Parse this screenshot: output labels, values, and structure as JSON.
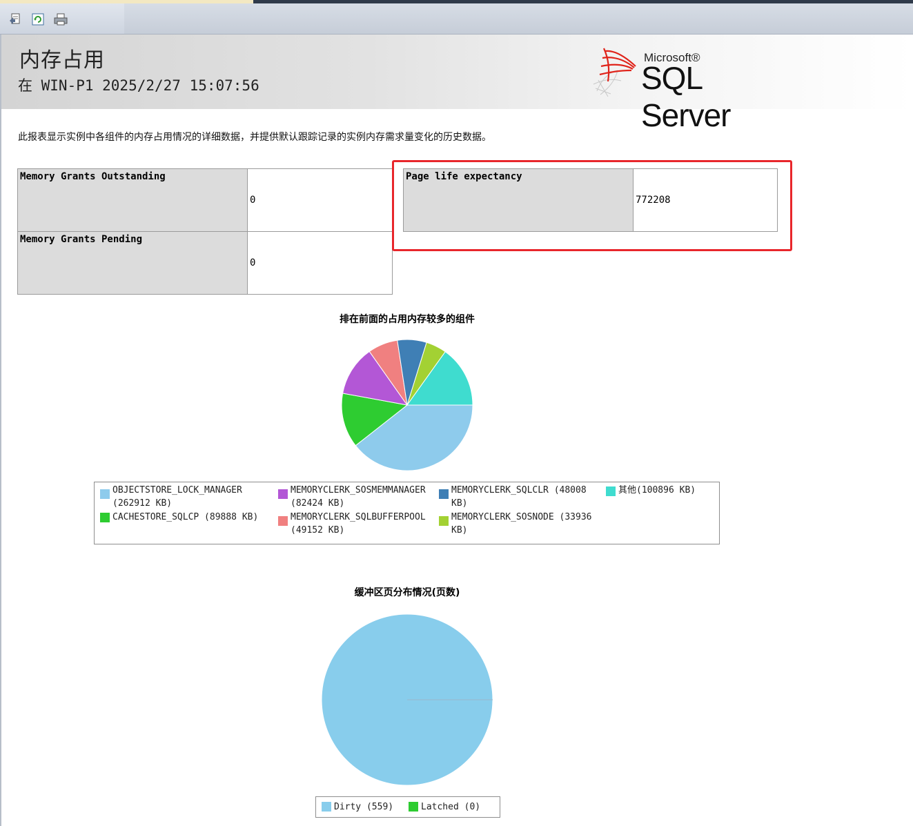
{
  "report": {
    "title": "内存占用",
    "subtitle": "在 WIN-P1 2025/2/27 15:07:56",
    "description": "此报表显示实例中各组件的内存占用情况的详细数据，并提供默认跟踪记录的实例内存需求量变化的历史数据。"
  },
  "logo": {
    "vendor": "Microsoft®",
    "product": "SQL Server"
  },
  "toolbar": {
    "icons": [
      "document-map-icon",
      "refresh-icon",
      "print-icon"
    ]
  },
  "stats": {
    "grants_outstanding": {
      "label": "Memory Grants Outstanding",
      "value": "0"
    },
    "grants_pending": {
      "label": "Memory Grants Pending",
      "value": "0"
    },
    "page_life": {
      "label": "Page life expectancy",
      "value": "772208"
    }
  },
  "legend1": {
    "items": [
      {
        "text1": "OBJECTSTORE_LOCK_MANAGER",
        "text2": "(262912 KB)"
      },
      {
        "text1": "CACHESTORE_SQLCP (89888 KB)",
        "text2": ""
      },
      {
        "text1": "MEMORYCLERK_SOSMEMMANAGER",
        "text2": "(82424 KB)"
      },
      {
        "text1": "MEMORYCLERK_SQLBUFFERPOOL",
        "text2": "(49152 KB)"
      },
      {
        "text1": "MEMORYCLERK_SQLCLR (48008",
        "text2": "KB)"
      },
      {
        "text1": "MEMORYCLERK_SOSNODE (33936",
        "text2": "KB)"
      },
      {
        "text1": "其他(100896 KB)",
        "text2": ""
      }
    ]
  },
  "legend2": {
    "items": [
      {
        "text": "Dirty (559)"
      },
      {
        "text": "Latched (0)"
      }
    ]
  },
  "chart_data": [
    {
      "type": "pie",
      "title": "排在前面的占用内存较多的组件",
      "categories": [
        "OBJECTSTORE_LOCK_MANAGER",
        "CACHESTORE_SQLCP",
        "MEMORYCLERK_SOSMEMMANAGER",
        "MEMORYCLERK_SQLBUFFERPOOL",
        "MEMORYCLERK_SQLCLR",
        "MEMORYCLERK_SOSNODE",
        "其他"
      ],
      "values": [
        262912,
        89888,
        82424,
        49152,
        48008,
        33936,
        100896
      ],
      "unit": "KB",
      "colors": [
        "#8ecbec",
        "#2ecc31",
        "#b357d6",
        "#f08080",
        "#3f7fb5",
        "#a3d133",
        "#3fdccf"
      ],
      "legend_position": "bottom"
    },
    {
      "type": "pie",
      "title": "缓冲区页分布情况(页数)",
      "categories": [
        "Dirty",
        "Latched"
      ],
      "values": [
        559,
        0
      ],
      "colors": [
        "#88cdec",
        "#2ecc31"
      ],
      "legend_position": "bottom"
    }
  ]
}
